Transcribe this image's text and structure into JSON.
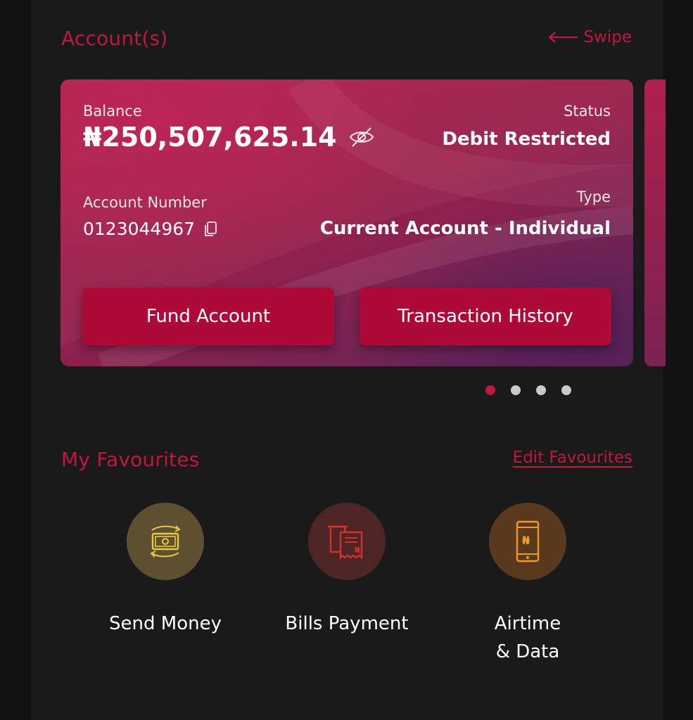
{
  "accounts": {
    "title": "Account(s)",
    "swipe_label": "Swipe",
    "card": {
      "balance_label": "Balance",
      "balance_value": "₦250,507,625.14",
      "status_label": "Status",
      "status_value": "Debit Restricted",
      "account_number_label": "Account Number",
      "account_number_value": "0123044967",
      "type_label": "Type",
      "type_value": "Current Account - Individual",
      "fund_button": "Fund Account",
      "history_button": "Transaction History"
    },
    "pager": {
      "count": 4,
      "active_index": 0
    }
  },
  "favourites": {
    "title": "My Favourites",
    "edit_label": "Edit Favourites",
    "items": [
      {
        "label": "Send Money",
        "icon": "money-transfer-icon",
        "bg": "#5c5030",
        "color": "#e9c742"
      },
      {
        "label": "Bills Payment",
        "icon": "receipt-icon",
        "bg": "#4e2525",
        "color": "#d3302c"
      },
      {
        "label": "Airtime\n& Data",
        "icon": "mobile-phone-icon",
        "bg": "#5a3a1f",
        "color": "#f29a1f"
      }
    ]
  },
  "colors": {
    "accent": "#c0173e",
    "button": "#ad0a37",
    "background": "#1b1a1b"
  }
}
